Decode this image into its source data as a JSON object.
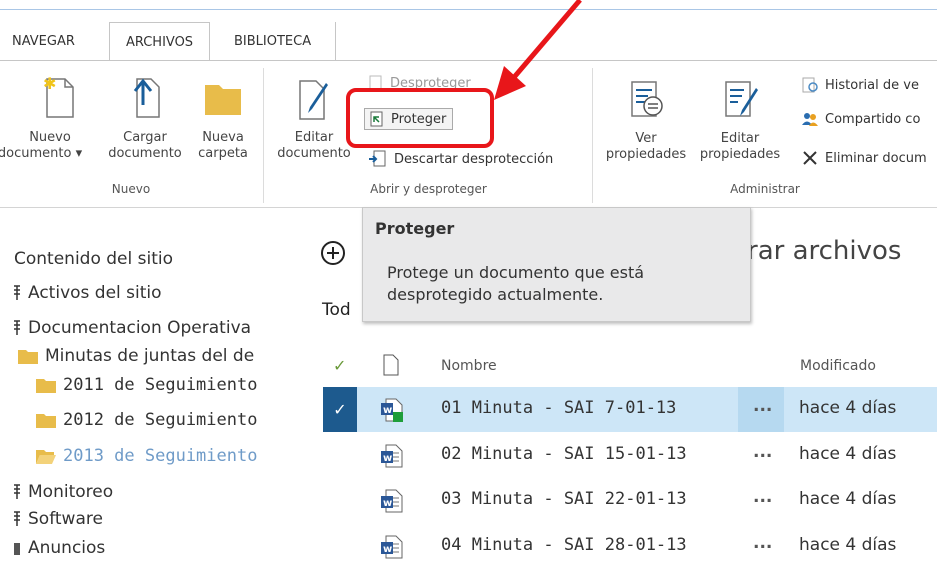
{
  "tabs": [
    {
      "label": "NAVEGAR"
    },
    {
      "label": "ARCHIVOS"
    },
    {
      "label": "BIBLIOTECA"
    }
  ],
  "ribbon": {
    "nuevo": {
      "new_doc_line1": "Nuevo",
      "new_doc_line2": "documento",
      "upload_line1": "Cargar",
      "upload_line2": "documento",
      "folder_line1": "Nueva",
      "folder_line2": "carpeta",
      "group_label": "Nuevo"
    },
    "abrir": {
      "edit_line1": "Editar",
      "edit_line2": "documento",
      "desproteger": "Desproteger",
      "proteger": "Proteger",
      "descartar": "Descartar desprotección",
      "group_label": "Abrir y desproteger"
    },
    "administrar": {
      "ver_line1": "Ver",
      "ver_line2": "propiedades",
      "editar_line1": "Editar",
      "editar_line2": "propiedades",
      "historial": "Historial de ve",
      "compartido": "Compartido co",
      "eliminar": "Eliminar docum",
      "group_label": "Administrar"
    }
  },
  "tooltip": {
    "title": "Proteger",
    "line1": "Protege un documento que está",
    "line2": "desprotegido actualmente."
  },
  "heading": {
    "partial": "rar archivos",
    "view_partial": "Tod"
  },
  "sidebar": {
    "items": [
      {
        "label": "Contenido del sitio"
      },
      {
        "label": "Activos del sitio"
      },
      {
        "label": "Documentacion Operativa"
      },
      {
        "label": "Minutas de juntas del de"
      },
      {
        "label": "2011 de Seguimiento"
      },
      {
        "label": "2012 de Seguimiento"
      },
      {
        "label": "2013 de Seguimiento"
      },
      {
        "label": "Monitoreo"
      },
      {
        "label": "Software"
      },
      {
        "label": "Anuncios"
      }
    ]
  },
  "list": {
    "col_name": "Nombre",
    "col_modified": "Modificado",
    "ellipsis": "...",
    "rows": [
      {
        "name": "01 Minuta - SAI 7-01-13",
        "modified": "hace 4 días"
      },
      {
        "name": "02 Minuta - SAI 15-01-13",
        "modified": "hace 4 días"
      },
      {
        "name": "03 Minuta - SAI 22-01-13",
        "modified": "hace 4 días"
      },
      {
        "name": "04 Minuta - SAI 28-01-13",
        "modified": "hace 4 días"
      }
    ]
  },
  "colors": {
    "highlight_red": "#e8161a",
    "selected_row": "#cde6f7",
    "selected_check": "#1d5a8e",
    "link_blue": "#6f9bc8",
    "folder_yellow": "#e8bc4a"
  }
}
